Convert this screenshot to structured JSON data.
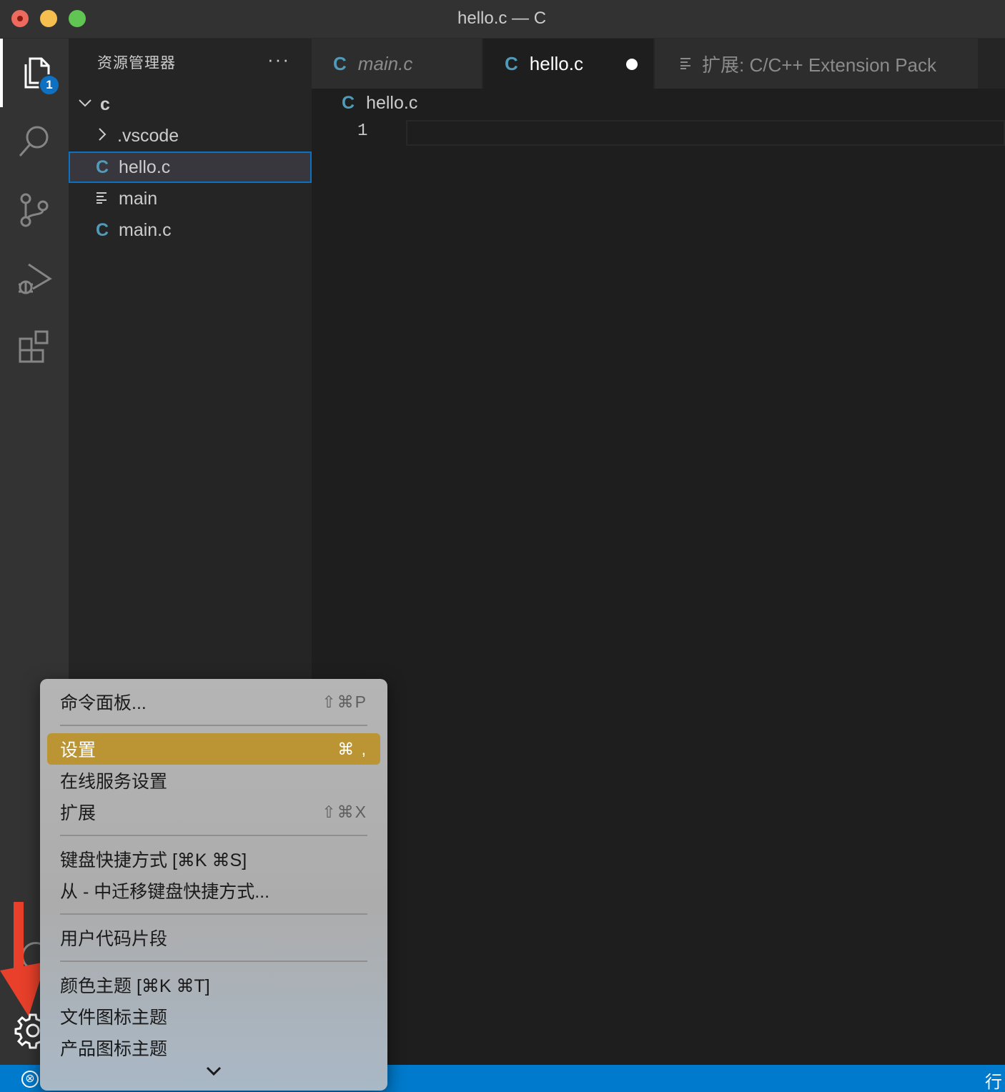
{
  "window": {
    "title": "hello.c — C"
  },
  "activity_bar": {
    "explorer_badge": "1"
  },
  "sidebar": {
    "title": "资源管理器",
    "more": "···",
    "folder": "c",
    "items": [
      {
        "label": ".vscode",
        "kind": "folder"
      },
      {
        "label": "hello.c",
        "kind": "c-file",
        "selected": true
      },
      {
        "label": "main",
        "kind": "text-file"
      },
      {
        "label": "main.c",
        "kind": "c-file"
      }
    ]
  },
  "tabs": [
    {
      "label": "main.c",
      "icon": "C",
      "active": false,
      "italic": true
    },
    {
      "label": "hello.c",
      "icon": "C",
      "active": true,
      "dirty": true
    },
    {
      "label": "扩展: C/C++ Extension Pack",
      "icon": "lines-icon",
      "active": false
    }
  ],
  "editor": {
    "breadcrumb": "hello.c",
    "breadcrumb_icon": "C",
    "line_numbers": [
      "1"
    ]
  },
  "menu": {
    "items": [
      {
        "label": "命令面板...",
        "shortcut": "⇧⌘P"
      },
      {
        "label": "设置",
        "shortcut": "⌘ ,",
        "highlighted": true
      },
      {
        "label": "在线服务设置",
        "shortcut": ""
      },
      {
        "label": "扩展",
        "shortcut": "⇧⌘X"
      },
      {
        "label": "键盘快捷方式 [⌘K ⌘S]",
        "shortcut": ""
      },
      {
        "label": "从 - 中迁移键盘快捷方式...",
        "shortcut": ""
      },
      {
        "label": "用户代码片段",
        "shortcut": ""
      },
      {
        "label": "颜色主题 [⌘K ⌘T]",
        "shortcut": ""
      },
      {
        "label": "文件图标主题",
        "shortcut": ""
      },
      {
        "label": "产品图标主题",
        "shortcut": ""
      }
    ]
  },
  "status_bar": {
    "error_icon": "⊗",
    "right_text": "行"
  },
  "colors": {
    "accent": "#007acc",
    "menu_highlight": "#bb9434",
    "c_icon": "#519aba",
    "annotation_arrow": "#e8402a"
  }
}
